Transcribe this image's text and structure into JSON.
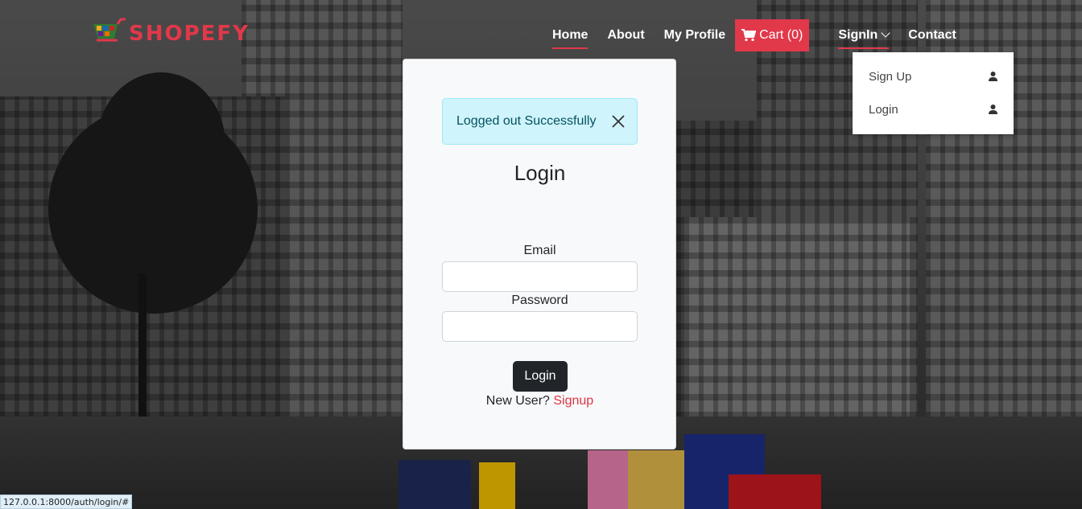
{
  "brand": {
    "name": "SHOPEFY",
    "accent": "#e1384a"
  },
  "nav": {
    "home": "Home",
    "about": "About",
    "profile": "My Profile",
    "cart": "Cart (0)",
    "signin": "SignIn",
    "contact": "Contact"
  },
  "dropdown": {
    "items": [
      {
        "label": "Sign Up",
        "icon": "user-icon"
      },
      {
        "label": "Login",
        "icon": "user-icon"
      }
    ]
  },
  "alert": {
    "message": "Logged out Successfully",
    "color": "#cff4fc"
  },
  "form": {
    "title": "Login",
    "email_label": "Email",
    "email_value": "",
    "password_label": "Password",
    "password_value": "",
    "submit": "Login",
    "new_user": "New User?",
    "signup_link": "Signup"
  },
  "status_bar": {
    "url": "127.0.0.1:8000/auth/login/#"
  }
}
